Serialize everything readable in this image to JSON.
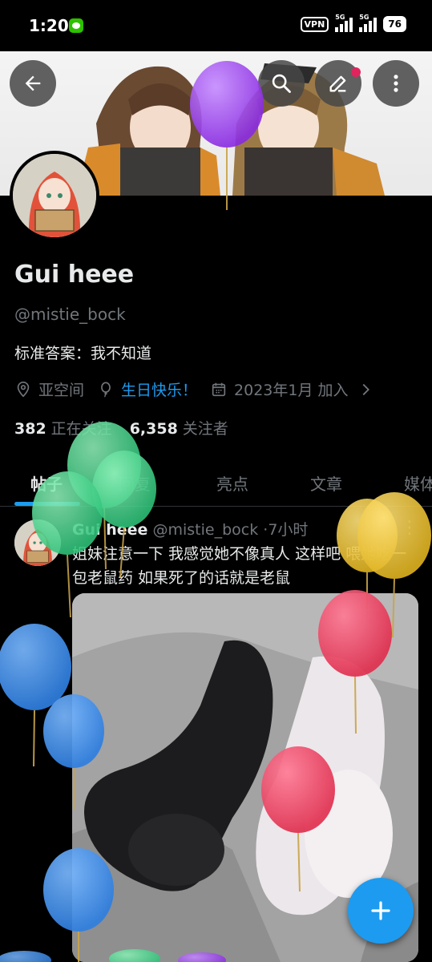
{
  "status_bar": {
    "time": "1:20",
    "vpn": "VPN",
    "signal1": "5G",
    "signal2": "5G",
    "battery": "76"
  },
  "profile": {
    "display_name": "Gui heee",
    "handle": "@mistie_bock",
    "bio": "标准答案：我不知道",
    "location": "亚空间",
    "birthday": "生日快乐！",
    "joined": "2023年1月 加入",
    "following_count": "382",
    "following_label": "正在关注",
    "followers_count": "6,358",
    "followers_label": "关注者"
  },
  "tabs": [
    {
      "label": "帖子"
    },
    {
      "label": "回复"
    },
    {
      "label": "亮点"
    },
    {
      "label": "文章"
    },
    {
      "label": "媒体"
    }
  ],
  "tweet": {
    "name": "Gui heee",
    "handle": "@mistie_bock",
    "separator": "·",
    "time": "7小时",
    "text": "姐妹注意一下 我感觉她不像真人 这样吧 喂她吃一包老鼠药 如果死了的话就是老鼠"
  },
  "icons": {
    "back": "back-arrow-icon",
    "search": "search-icon",
    "edit": "edit-icon",
    "more": "more-vertical-icon",
    "location": "location-pin-icon",
    "birthday": "balloon-icon",
    "calendar": "calendar-icon",
    "compose": "plus-icon"
  },
  "colors": {
    "accent": "#1d9bf0",
    "background": "#000000",
    "muted": "#71767b"
  }
}
